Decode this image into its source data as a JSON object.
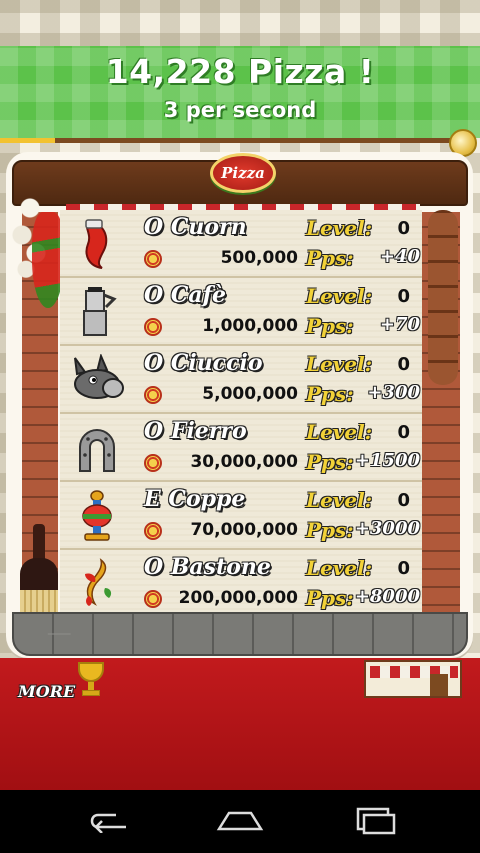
{
  "header": {
    "pizza_count": "14,228 Pizza !",
    "per_second": "3 per second"
  },
  "progress": {
    "fraction": 0.12
  },
  "logo_text": "Pizza",
  "colors": {
    "header_green": "#5cc24a",
    "level_yellow": "#f2d238",
    "floor_red": "#c21a1d",
    "wood_brown": "#6e3b1c"
  },
  "labels": {
    "level": "Level:",
    "pps": "Pps:"
  },
  "items": [
    {
      "name": "O Cuorn",
      "cost": "500,000",
      "level": "0",
      "pps": "+40",
      "icon": "red-horn-charm-icon"
    },
    {
      "name": "O Cafè",
      "cost": "1,000,000",
      "level": "0",
      "pps": "+70",
      "icon": "moka-coffee-pot-icon"
    },
    {
      "name": "O Ciuccio",
      "cost": "5,000,000",
      "level": "0",
      "pps": "+300",
      "icon": "donkey-head-icon"
    },
    {
      "name": "O Fierro",
      "cost": "30,000,000",
      "level": "0",
      "pps": "+1500",
      "icon": "horseshoe-icon"
    },
    {
      "name": "E Coppe",
      "cost": "70,000,000",
      "level": "0",
      "pps": "+3000",
      "icon": "cups-suit-icon"
    },
    {
      "name": "O Bastone",
      "cost": "200,000,000",
      "level": "0",
      "pps": "+8000",
      "icon": "clubs-suit-icon"
    }
  ],
  "bottom": {
    "more_label": "MORE"
  }
}
